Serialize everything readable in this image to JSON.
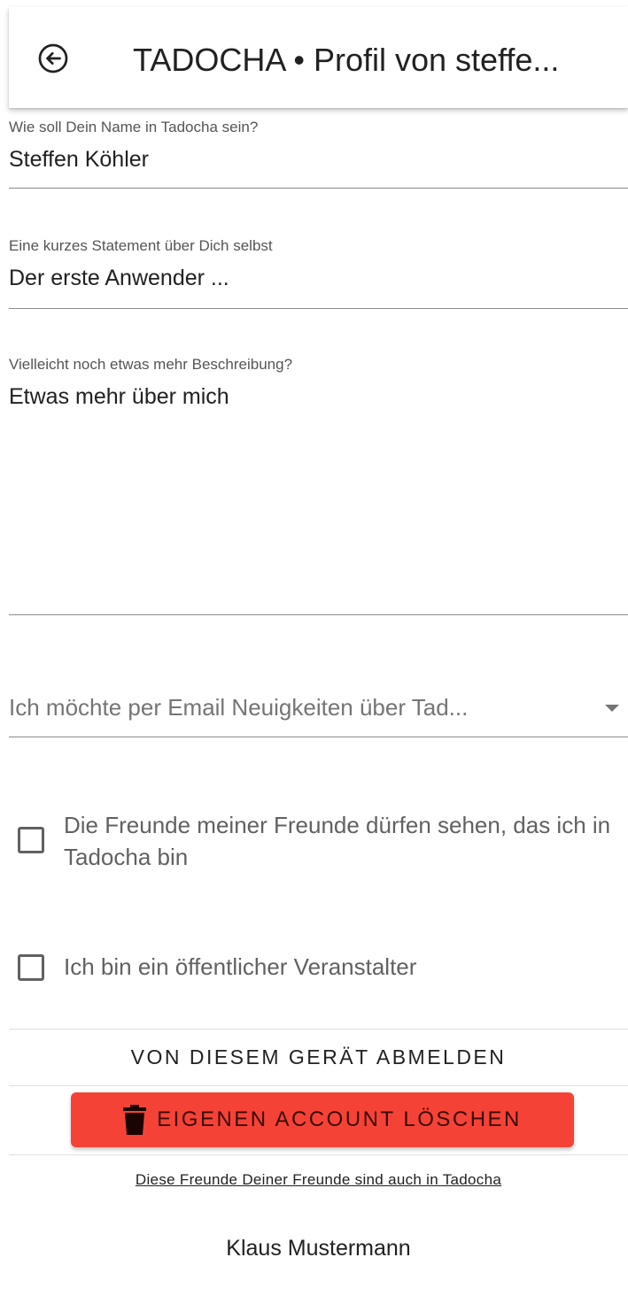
{
  "appbar": {
    "title": "TADOCHA • Profil von steffe..."
  },
  "form": {
    "name": {
      "label": "Wie soll Dein Name in Tadocha sein?",
      "value": "Steffen Köhler"
    },
    "statement": {
      "label": "Eine kurzes Statement über Dich selbst",
      "value": "Der erste Anwender ..."
    },
    "description": {
      "label": "Vielleicht noch etwas mehr Beschreibung?",
      "value": "Etwas mehr über mich"
    },
    "newsletter_select": {
      "value": "Ich möchte per Email Neuigkeiten über Tad..."
    },
    "checkbox_friends": {
      "label": "Die Freunde meiner Freunde dürfen sehen, das ich in Tadocha bin",
      "checked": false
    },
    "checkbox_organizer": {
      "label": "Ich bin ein öffentlicher Veranstalter",
      "checked": false
    }
  },
  "actions": {
    "logout_label": "VON DIESEM GERÄT ABMELDEN",
    "delete_label": "EIGENEN ACCOUNT LÖSCHEN"
  },
  "friends": {
    "link_text": "Diese Freunde Deiner Freunde sind auch in Tadocha",
    "items": [
      "Klaus Mustermann"
    ]
  },
  "colors": {
    "danger": "#f44336",
    "danger_text": "#3a0a06",
    "text": "#212121",
    "secondary_text": "#757575"
  },
  "icons": {
    "back": "arrow-left-circle-icon",
    "delete": "trash-icon",
    "select": "caret-down-icon"
  }
}
